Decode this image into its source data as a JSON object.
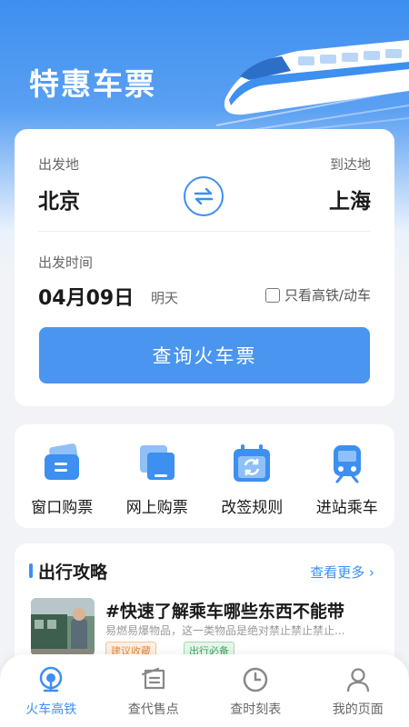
{
  "header": {
    "title": "特惠车票"
  },
  "search": {
    "from_label": "出发地",
    "from_city": "北京",
    "to_label": "到达地",
    "to_city": "上海",
    "date_label": "出发时间",
    "date": "04月09日",
    "date_hint": "明天",
    "hsr_only_label": "只看高铁/动车",
    "hsr_only_checked": false,
    "query_button": "查询火车票"
  },
  "services": [
    {
      "label": "窗口购票",
      "icon": "ticket-window-icon"
    },
    {
      "label": "网上购票",
      "icon": "online-ticket-icon"
    },
    {
      "label": "改签规则",
      "icon": "refresh-calendar-icon"
    },
    {
      "label": "进站乘车",
      "icon": "train-icon"
    }
  ],
  "guide": {
    "title": "出行攻略",
    "more": "查看更多",
    "article": {
      "title": "#快速了解乘车哪些东西不能带",
      "summary": "易燃易爆物品，这一类物品是绝对禁止禁止禁止...",
      "tags": [
        "建议收藏",
        "出行必备"
      ]
    }
  },
  "tabbar": {
    "items": [
      {
        "label": "火车高铁",
        "icon": "train-rail-icon",
        "active": true
      },
      {
        "label": "查代售点",
        "icon": "ticket-icon",
        "active": false
      },
      {
        "label": "查时刻表",
        "icon": "clock-icon",
        "active": false
      },
      {
        "label": "我的页面",
        "icon": "user-icon",
        "active": false
      }
    ]
  },
  "colors": {
    "primary": "#3d8ff0",
    "button": "#4a95f0",
    "tag_orange": "#e98a3a",
    "tag_green": "#3aa85e"
  }
}
